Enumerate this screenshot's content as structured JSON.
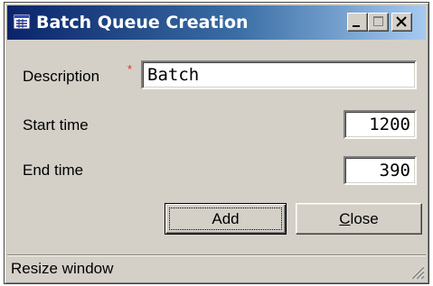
{
  "window": {
    "title": "Batch Queue Creation",
    "icon": "window-app-icon",
    "controls": [
      "minimize-icon",
      "maximize-icon",
      "close-icon"
    ]
  },
  "form": {
    "description_label": "Description",
    "required_marker": "*",
    "description_value": "Batch",
    "start_label": "Start time",
    "start_value": "1200",
    "end_label": "End time",
    "end_value": "390"
  },
  "buttons": {
    "add_label": "Add",
    "close_label_prefix": "C",
    "close_label_rest": "lose"
  },
  "status": {
    "text": "Resize window"
  },
  "colors": {
    "title_start": "#0a246a",
    "title_end": "#a6caf0",
    "face": "#d4d0c8",
    "required": "#e03030"
  }
}
